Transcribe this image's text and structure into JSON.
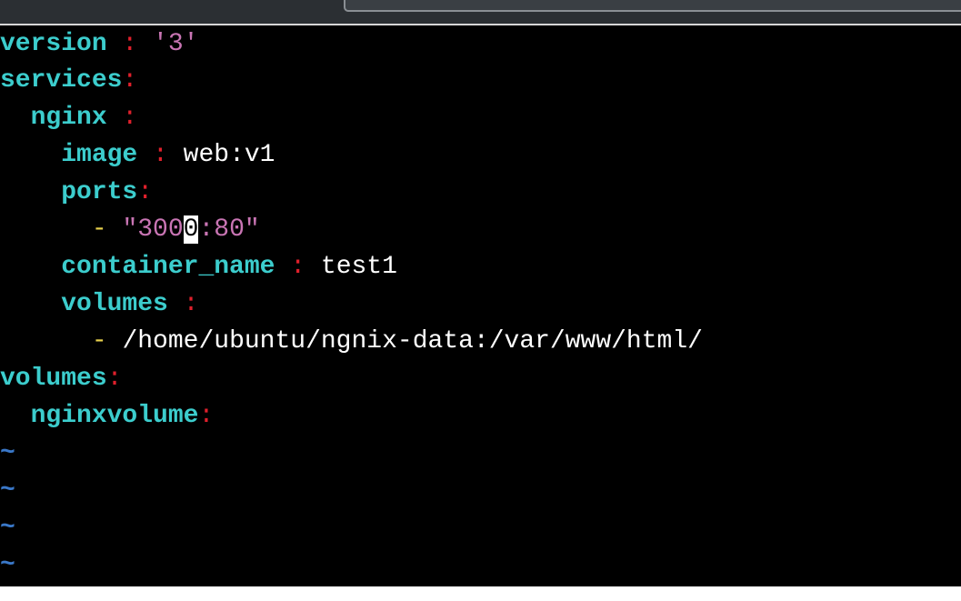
{
  "editor": {
    "lines": [
      {
        "indent": "",
        "key": "version",
        "sep": " : ",
        "str": "'3'"
      },
      {
        "indent": "",
        "key": "services",
        "sep": ":"
      },
      {
        "indent": "  ",
        "key": "nginx",
        "sep": " :"
      },
      {
        "indent": "    ",
        "key": "image",
        "sep": " : ",
        "val": "web:v1"
      },
      {
        "indent": "    ",
        "key": "ports",
        "sep": ":"
      },
      {
        "indent": "      ",
        "dash": "-",
        "str_before": " \"300",
        "cursor_char": "0",
        "str_after": ":80\""
      },
      {
        "indent": "    ",
        "key": "container_name",
        "sep": " : ",
        "val": "test1"
      },
      {
        "indent": "    ",
        "key": "volumes",
        "sep": " :"
      },
      {
        "indent": "      ",
        "dash": "-",
        "val": " /home/ubuntu/ngnix-data:/var/www/html/"
      },
      {
        "indent": "",
        "key": "volumes",
        "sep": ":"
      },
      {
        "indent": "  ",
        "key": "nginxvolume",
        "sep": ":"
      }
    ],
    "empty_marker": "~",
    "empty_line_count": 4
  },
  "colors": {
    "background": "#000000",
    "key": "#3ccdcd",
    "colon": "#e0202c",
    "string": "#c975b4",
    "dash": "#e9d24d",
    "value": "#ffffff",
    "tilde": "#3a78c9",
    "cursor": "#ffffff"
  }
}
